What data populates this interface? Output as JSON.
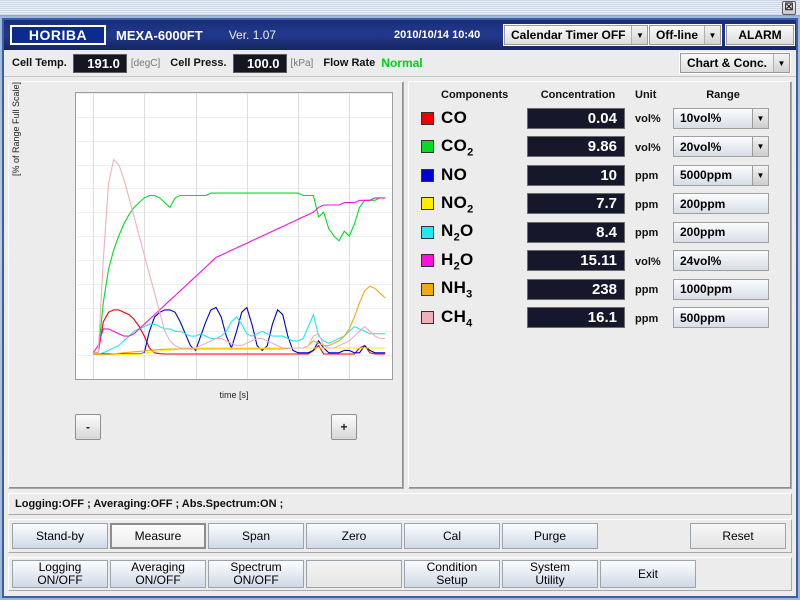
{
  "window": {
    "close_label": "☒"
  },
  "header": {
    "logo": "HORIBA",
    "model": "MEXA-6000FT",
    "version": "Ver. 1.07",
    "datetime": "2010/10/14 10:40",
    "calendar_timer": "Calendar Timer OFF",
    "online_state": "Off-line",
    "alarm": "ALARM"
  },
  "subheader": {
    "cell_temp_label": "Cell Temp.",
    "cell_temp_value": "191.0",
    "cell_temp_unit": "[degC]",
    "cell_press_label": "Cell Press.",
    "cell_press_value": "100.0",
    "cell_press_unit": "[kPa]",
    "flow_rate_label": "Flow Rate",
    "flow_rate_value": "Normal",
    "view_mode": "Chart & Conc."
  },
  "chart": {
    "zoom_out": "-",
    "zoom_in": "+"
  },
  "concentration": {
    "headers": {
      "components": "Components",
      "concentration": "Concentration",
      "unit": "Unit",
      "range": "Range"
    },
    "rows": [
      {
        "name": "CO",
        "sub": "",
        "color": "#ee0000",
        "value": "0.04",
        "unit": "vol%",
        "range": "10vol%",
        "range_dropdown": true
      },
      {
        "name": "CO",
        "sub": "2",
        "color": "#00dd22",
        "value": "9.86",
        "unit": "vol%",
        "range": "20vol%",
        "range_dropdown": true
      },
      {
        "name": "NO",
        "sub": "",
        "color": "#0000cc",
        "value": "10",
        "unit": "ppm",
        "range": "5000ppm",
        "range_dropdown": true
      },
      {
        "name": "NO",
        "sub": "2",
        "color": "#ffee00",
        "value": "7.7",
        "unit": "ppm",
        "range": "200ppm",
        "range_dropdown": false
      },
      {
        "name": "N",
        "sub": "2",
        "suffix": "O",
        "color": "#22e8f0",
        "value": "8.4",
        "unit": "ppm",
        "range": "200ppm",
        "range_dropdown": false
      },
      {
        "name": "H",
        "sub": "2",
        "suffix": "O",
        "color": "#ff11dd",
        "value": "15.11",
        "unit": "vol%",
        "range": "24vol%",
        "range_dropdown": false
      },
      {
        "name": "NH",
        "sub": "3",
        "color": "#f0a818",
        "value": "238",
        "unit": "ppm",
        "range": "1000ppm",
        "range_dropdown": false
      },
      {
        "name": "CH",
        "sub": "4",
        "color": "#f0b0b8",
        "value": "16.1",
        "unit": "ppm",
        "range": "500ppm",
        "range_dropdown": false
      }
    ]
  },
  "status": "Logging:OFF ; Averaging:OFF ; Abs.Spectrum:ON ;",
  "buttons_row1": [
    {
      "label": "Stand-by",
      "selected": false
    },
    {
      "label": "Measure",
      "selected": true
    },
    {
      "label": "Span",
      "selected": false
    },
    {
      "label": "Zero",
      "selected": false
    },
    {
      "label": "Cal",
      "selected": false
    },
    {
      "label": "Purge",
      "selected": false
    },
    {
      "label": "Reset",
      "selected": false
    }
  ],
  "buttons_row2": [
    {
      "label": "Logging\nON/OFF"
    },
    {
      "label": "Averaging\nON/OFF"
    },
    {
      "label": "Spectrum\nON/OFF"
    },
    {
      "label": ""
    },
    {
      "label": "Condition\nSetup"
    },
    {
      "label": "System\nUtility"
    },
    {
      "label": "Exit"
    }
  ],
  "chart_data": {
    "type": "line",
    "title": "",
    "xlabel": "time [s]",
    "ylabel": "[% of Range Full Scale]",
    "xlim": [
      -10,
      175
    ],
    "ylim": [
      -10,
      110
    ],
    "xticks": [
      0,
      30,
      60,
      90,
      120,
      150
    ],
    "yticks": [
      -10,
      0,
      10,
      20,
      30,
      40,
      50,
      60,
      70,
      80,
      90,
      100,
      110
    ],
    "grid": true,
    "legend": "external-component-table",
    "x": [
      0,
      3,
      6,
      9,
      12,
      15,
      18,
      21,
      24,
      27,
      30,
      33,
      36,
      39,
      42,
      45,
      48,
      51,
      54,
      57,
      60,
      63,
      66,
      69,
      72,
      75,
      78,
      81,
      84,
      87,
      90,
      93,
      96,
      99,
      102,
      105,
      108,
      111,
      114,
      117,
      120,
      123,
      126,
      129,
      132,
      135,
      138,
      141,
      144,
      147,
      150,
      153,
      156,
      159,
      162,
      165,
      168,
      171
    ],
    "series": [
      {
        "name": "CO",
        "color": "#ee0000",
        "values": [
          1,
          1,
          14,
          18,
          19,
          19,
          18,
          17,
          15,
          12,
          8,
          3,
          1,
          0.6,
          0.5,
          0.5,
          0.5,
          0.5,
          0.5,
          0.5,
          0.5,
          0.5,
          0.5,
          0.5,
          0.5,
          0.5,
          0.5,
          0.5,
          0.5,
          0.5,
          0.5,
          0.5,
          0.5,
          0.5,
          0.5,
          0.5,
          0.5,
          0.5,
          0.5,
          0.5,
          0.5,
          0.5,
          0.5,
          2,
          4,
          0.5,
          0.5,
          0.5,
          0.5,
          0.5,
          0.5,
          0.5,
          3,
          4,
          1,
          0.5,
          0.5,
          0.5
        ]
      },
      {
        "name": "CO2",
        "color": "#00dd22",
        "values": [
          1,
          1,
          22,
          36,
          44,
          50,
          55,
          59,
          62,
          64,
          66,
          67,
          67,
          66,
          64,
          62,
          66,
          67,
          67,
          67,
          67,
          67,
          67,
          68,
          68,
          68,
          68,
          68,
          68,
          68,
          68,
          68,
          68,
          68,
          68,
          68,
          68,
          68,
          68,
          68,
          68,
          67,
          67,
          67,
          58,
          60,
          53,
          50,
          48,
          52,
          50,
          55,
          62,
          65,
          65,
          65,
          66,
          66
        ]
      },
      {
        "name": "NO",
        "color": "#0000cc",
        "values": [
          0.5,
          0.5,
          0.5,
          0.5,
          0.5,
          0.5,
          0.5,
          0.5,
          0.5,
          0.5,
          1,
          10,
          16,
          18,
          19,
          19,
          18,
          14,
          9,
          4,
          2,
          8,
          14,
          19,
          20,
          16,
          8,
          3,
          10,
          18,
          20,
          13,
          4,
          2,
          4,
          13,
          19,
          17,
          8,
          2,
          1,
          1,
          1,
          2,
          6,
          3,
          1,
          1,
          1,
          2,
          2,
          1,
          1,
          4,
          2,
          1,
          1,
          1
        ]
      },
      {
        "name": "NO2",
        "color": "#ffee00",
        "values": [
          0.3,
          0.3,
          0.3,
          0.3,
          0.3,
          0.3,
          0.3,
          0.3,
          0.3,
          0.3,
          0.8,
          1.2,
          1.5,
          1.8,
          2,
          2.2,
          2.4,
          2.6,
          2.8,
          3,
          3,
          3,
          3,
          3,
          3,
          3,
          3,
          3,
          3,
          3,
          3,
          3,
          3,
          3,
          3,
          3,
          3,
          3,
          3,
          3,
          3,
          3,
          3,
          3,
          3,
          3,
          3,
          3,
          3,
          3,
          3,
          3,
          3,
          3,
          3,
          3,
          3,
          3
        ]
      },
      {
        "name": "N2O",
        "color": "#22e8f0",
        "values": [
          0.5,
          0.5,
          1,
          2,
          3,
          4,
          6,
          8,
          10,
          11,
          12,
          13,
          13,
          12,
          11,
          11,
          10,
          10,
          9,
          8,
          8,
          9,
          8,
          7,
          7,
          8,
          10,
          14,
          16,
          13,
          9,
          8,
          9,
          10,
          9,
          8,
          8,
          8,
          7,
          6,
          6,
          7,
          12,
          17,
          8,
          6,
          5,
          6,
          7,
          8,
          10,
          12,
          11,
          10,
          9,
          9,
          9,
          9
        ]
      },
      {
        "name": "H2O",
        "color": "#ff11dd",
        "values": [
          1,
          4,
          11,
          11,
          10,
          9,
          8,
          8,
          9,
          11,
          13,
          15,
          17,
          19,
          21,
          23,
          25,
          27,
          29,
          31,
          33,
          35,
          37,
          39,
          41,
          42,
          43,
          44,
          45,
          46,
          47,
          48,
          49,
          50,
          51,
          52,
          53,
          54,
          55,
          56,
          57,
          58,
          59,
          60,
          62,
          63,
          63,
          63,
          63,
          64,
          64,
          64,
          65,
          65,
          65,
          66,
          66,
          66
        ]
      },
      {
        "name": "NH3",
        "color": "#f0a818",
        "values": [
          0.3,
          0.3,
          0.3,
          0.3,
          0.5,
          0.8,
          1,
          1.2,
          1.4,
          1.6,
          1.8,
          2,
          2.2,
          2.4,
          2.5,
          2.6,
          2.6,
          2.6,
          2.6,
          2.6,
          2.6,
          2.6,
          2.6,
          2.6,
          2.6,
          2.6,
          2.6,
          2.6,
          2.6,
          2.6,
          2.6,
          2.6,
          2.6,
          2.6,
          2.6,
          2.6,
          2.6,
          2.6,
          2.8,
          3,
          3,
          3,
          4,
          6,
          5,
          4,
          4,
          5,
          6,
          8,
          11,
          16,
          22,
          27,
          29,
          28,
          26,
          24
        ]
      },
      {
        "name": "CH4",
        "color": "#f0b0b8",
        "values": [
          1,
          1,
          40,
          72,
          82,
          80,
          74,
          66,
          58,
          50,
          42,
          34,
          26,
          18,
          10,
          6,
          4,
          3,
          3,
          3,
          3,
          4,
          5,
          6,
          7,
          7,
          6,
          5,
          4,
          4,
          5,
          6,
          7,
          7,
          6,
          5,
          4,
          3,
          3,
          3,
          3,
          3,
          4,
          8,
          9,
          4,
          3,
          3,
          4,
          5,
          6,
          8,
          10,
          12,
          10,
          8,
          7,
          7
        ]
      }
    ]
  }
}
